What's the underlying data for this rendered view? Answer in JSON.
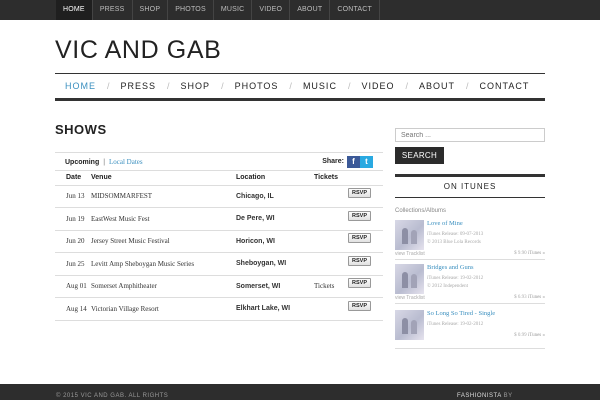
{
  "topnav": [
    "HOME",
    "PRESS",
    "SHOP",
    "PHOTOS",
    "MUSIC",
    "VIDEO",
    "ABOUT",
    "CONTACT"
  ],
  "site_title": "VIC AND GAB",
  "mainnav": [
    "HOME",
    "PRESS",
    "SHOP",
    "PHOTOS",
    "MUSIC",
    "VIDEO",
    "ABOUT",
    "CONTACT"
  ],
  "shows": {
    "heading": "SHOWS",
    "tab_upcoming": "Upcoming",
    "tab_separator": "|",
    "tab_local": "Local Dates",
    "share_label": "Share:",
    "share_fb": "f",
    "share_tw": "t",
    "columns": [
      "Date",
      "Venue",
      "Location",
      "Tickets"
    ],
    "rows": [
      {
        "date": "Jun 13",
        "venue": "MIDSOMMARFEST",
        "location": "Chicago, IL",
        "tickets": "",
        "rsvp": "RSVP"
      },
      {
        "date": "Jun 19",
        "venue": "EastWest Music Fest",
        "location": "De Pere, WI",
        "tickets": "",
        "rsvp": "RSVP"
      },
      {
        "date": "Jun 20",
        "venue": "Jersey Street Music Festival",
        "location": "Horicon, WI",
        "tickets": "",
        "rsvp": "RSVP"
      },
      {
        "date": "Jun 25",
        "venue": "Levitt Amp Sheboygan Music Series",
        "location": "Sheboygan, WI",
        "tickets": "",
        "rsvp": "RSVP"
      },
      {
        "date": "Aug 01",
        "venue": "Somerset Amphitheater",
        "location": "Somerset, WI",
        "tickets": "Tickets",
        "rsvp": "RSVP"
      },
      {
        "date": "Aug 14",
        "venue": "Victorian Village Resort",
        "location": "Elkhart Lake, WI",
        "tickets": "",
        "rsvp": "RSVP"
      }
    ]
  },
  "sidebar": {
    "search_placeholder": "Search ...",
    "search_button": "SEARCH",
    "itunes_title": "ON ITUNES",
    "collections_label": "Collections/Albums",
    "albums": [
      {
        "title": "Love of Mine",
        "release": "iTunes Release: 09-07-2013",
        "label": "© 2013 Blue Lola Records",
        "link": "view Tracklist",
        "price": "$ 9.90",
        "store": "iTunes »"
      },
      {
        "title": "Bridges and Guns",
        "release": "iTunes Release: 19-02-2012",
        "label": "© 2012 Independent",
        "link": "view Tracklist",
        "price": "$ 6.93",
        "store": "iTunes »"
      },
      {
        "title": "So Long So Tired - Single",
        "release": "iTunes Release: 19-02-2012",
        "label": "© 2012 Independent",
        "link": "",
        "price": "$ 0.99",
        "store": "iTunes »"
      }
    ]
  },
  "footer": {
    "copyright": "© 2015 VIC AND GAB. ALL RIGHTS",
    "brand": "FASHIONISTA",
    "by": "BY"
  },
  "colors": {
    "accent": "#3a8fbf",
    "dark_bar": "#2d2d2d",
    "facebook": "#3b5998",
    "twitter": "#29a9e1"
  }
}
